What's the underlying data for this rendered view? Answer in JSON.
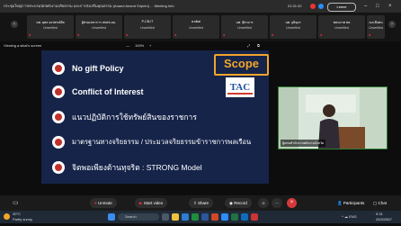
{
  "titlebar": {
    "title": "ประชุมใหญ่การพระบรมนักพลังงานจริยธรรม และการส่งเสริมคุณธรรม (Anand Anand Sriprim) ... Meeting Info",
    "time": "01:31:32",
    "leave_label": "Leave"
  },
  "participants": [
    {
      "name": "นพ. ยุทธ ยงรพรณ์ศิล",
      "status": "Unverified"
    },
    {
      "name": "ผู้ช่วยเลขาการ สปสช.มม.",
      "status": "Unverified"
    },
    {
      "name": "P-CB-IT",
      "status": "Unverified"
    },
    {
      "name": "a.sikai",
      "status": "Unverified"
    },
    {
      "name": "นพ. อุ๊หาดาร",
      "status": "Unverified"
    },
    {
      "name": "นพ. อุษิจุดร",
      "status": "Unverified"
    },
    {
      "name": "พหมภาศ พล",
      "status": "Unverified"
    },
    {
      "name": "ณะเลือพน",
      "status": "Unverified"
    }
  ],
  "sharebar": {
    "viewing": "Viewing a.sikai's screen",
    "zoom": "100%"
  },
  "slide": {
    "badge": "Scope",
    "logo": "TAC",
    "items": [
      "No gift Policy",
      "Conflict of Interest",
      "แนวปฏิบัติการใช้ทรัพย์สินของราชการ",
      "มาตรฐานทางจริยธรรม / ประมวลจริยธรรมข้าราชการพลเรือน",
      "จิตพอเพียงต้านทุจริต : STRONG Model"
    ]
  },
  "video": {
    "label": "ผู้แทนสำนักงานพลังงานจังหวัด"
  },
  "toolbar": {
    "unmute": "Unmute",
    "start_video": "Start video",
    "share": "Share",
    "record": "Record",
    "participants": "Participants",
    "chat": "Chat"
  },
  "taskbar": {
    "weather_temp": "30°C",
    "weather_desc": "Partly sunny",
    "search": "Search",
    "time": "9:31",
    "date": "26/3/2567"
  },
  "colors": {
    "slide_bg": "#16244a",
    "accent_orange": "#f2a52a",
    "leave_red": "#d63939",
    "video_border": "#2e7d32"
  }
}
